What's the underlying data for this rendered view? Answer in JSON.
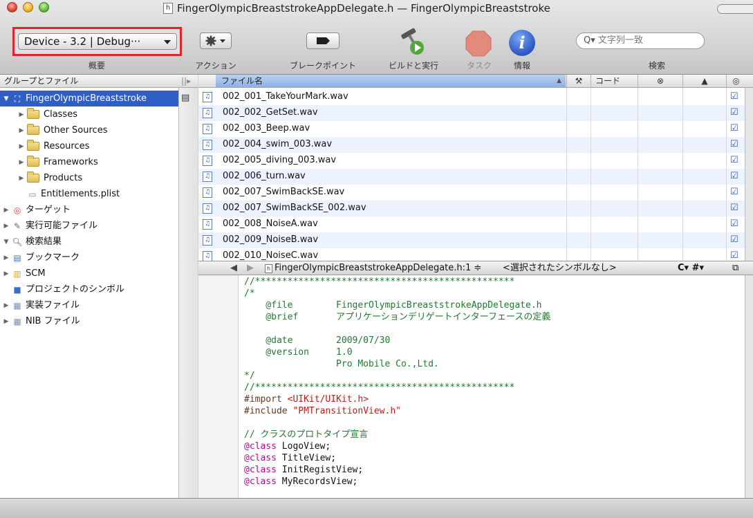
{
  "window": {
    "title": "FingerOlympicBreaststrokeAppDelegate.h — FingerOlympicBreaststroke",
    "header_file_icon": "h"
  },
  "toolbar": {
    "overview_value": "Device - 3.2 | Debug···",
    "overview_label": "概要",
    "action_label": "アクション",
    "breakpoints_label": "ブレークポイント",
    "build_run_label": "ビルドと実行",
    "tasks_label": "タスク",
    "info_label": "情報",
    "search_label": "検索",
    "search_placeholder": "文字列一致",
    "info_glyph": "i"
  },
  "sidebar": {
    "header": "グループとファイル",
    "items": [
      {
        "label": "FingerOlympicBreaststroke",
        "icon": "project-icon",
        "depth": 0,
        "selected": true,
        "disclosure": "▼"
      },
      {
        "label": "Classes",
        "icon": "folder-icon",
        "depth": 1,
        "disclosure": "▶"
      },
      {
        "label": "Other Sources",
        "icon": "folder-icon",
        "depth": 1,
        "disclosure": "▶"
      },
      {
        "label": "Resources",
        "icon": "folder-icon",
        "depth": 1,
        "disclosure": "▶"
      },
      {
        "label": "Frameworks",
        "icon": "folder-icon",
        "depth": 1,
        "disclosure": "▶"
      },
      {
        "label": "Products",
        "icon": "folder-icon",
        "depth": 1,
        "disclosure": "▶"
      },
      {
        "label": "Entitlements.plist",
        "icon": "plist-file-icon",
        "depth": 1,
        "disclosure": ""
      },
      {
        "label": "ターゲット",
        "icon": "target-icon",
        "depth": 0,
        "disclosure": "▶"
      },
      {
        "label": "実行可能ファイル",
        "icon": "executable-icon",
        "depth": 0,
        "disclosure": "▶"
      },
      {
        "label": "検索結果",
        "icon": "magnifier-icon",
        "depth": 0,
        "disclosure": "▼"
      },
      {
        "label": "ブックマーク",
        "icon": "bookmark-icon",
        "depth": 0,
        "disclosure": "▶"
      },
      {
        "label": "SCM",
        "icon": "scm-icon",
        "depth": 0,
        "disclosure": "▶"
      },
      {
        "label": "プロジェクトのシンボル",
        "icon": "cube-icon",
        "depth": 0,
        "disclosure": ""
      },
      {
        "label": "実装ファイル",
        "icon": "smart-group-icon",
        "depth": 0,
        "disclosure": "▶"
      },
      {
        "label": "NIB ファイル",
        "icon": "smart-group-icon",
        "depth": 0,
        "disclosure": "▶"
      }
    ]
  },
  "filelist": {
    "columns": {
      "name": "ファイル名",
      "code": "コード",
      "errors_glyph": "⊗",
      "warnings_glyph": "▲",
      "target_glyph": "◎"
    },
    "rows": [
      "002_001_TakeYourMark.wav",
      "002_002_GetSet.wav",
      "002_003_Beep.wav",
      "002_004_swim_003.wav",
      "002_005_diving_003.wav",
      "002_006_turn.wav",
      "002_007_SwimBackSE.wav",
      "002_007_SwimBackSE_002.wav",
      "002_008_NoiseA.wav",
      "002_009_NoiseB.wav",
      "002_010_NoiseC.wav"
    ]
  },
  "editor": {
    "file_popup": "FingerOlympicBreaststrokeAppDelegate.h:1 ≑",
    "symbol_popup": "<選択されたシンボルなし>",
    "right_controls": "C▾  #▾",
    "lines": [
      {
        "text": "//************************************************",
        "color": "green"
      },
      {
        "text": "/*",
        "color": "green"
      },
      {
        "text": "    @file        FingerOlympicBreaststrokeAppDelegate.h",
        "color": "green"
      },
      {
        "text": "    @brief       アプリケーションデリゲートインターフェースの定義",
        "color": "green"
      },
      {
        "text": "",
        "color": "green"
      },
      {
        "text": "    @date        2009/07/30",
        "color": "green"
      },
      {
        "text": "    @version     1.0",
        "color": "green"
      },
      {
        "text": "                 Pro Mobile Co.,Ltd.",
        "color": "green"
      },
      {
        "text": "*/",
        "color": "green"
      },
      {
        "text": "//************************************************",
        "color": "green"
      },
      {
        "text": "#import <UIKit/UIKit.h>",
        "color": "import"
      },
      {
        "text": "#include \"PMTransitionView.h\"",
        "color": "include"
      },
      {
        "text": "",
        "color": "black"
      },
      {
        "text": "// クラスのプロトタイプ宣言",
        "color": "green"
      },
      {
        "text": "@class LogoView;",
        "color": "class"
      },
      {
        "text": "@class TitleView;",
        "color": "class"
      },
      {
        "text": "@class InitRegistView;",
        "color": "class"
      },
      {
        "text": "@class MyRecordsView;",
        "color": "class"
      }
    ]
  },
  "colors": {
    "selection": "#2d5fc4",
    "highlight_box": "#e0262b",
    "comment": "#1f7a2e",
    "string": "#c41a16",
    "keyword": "#aa0d91"
  }
}
